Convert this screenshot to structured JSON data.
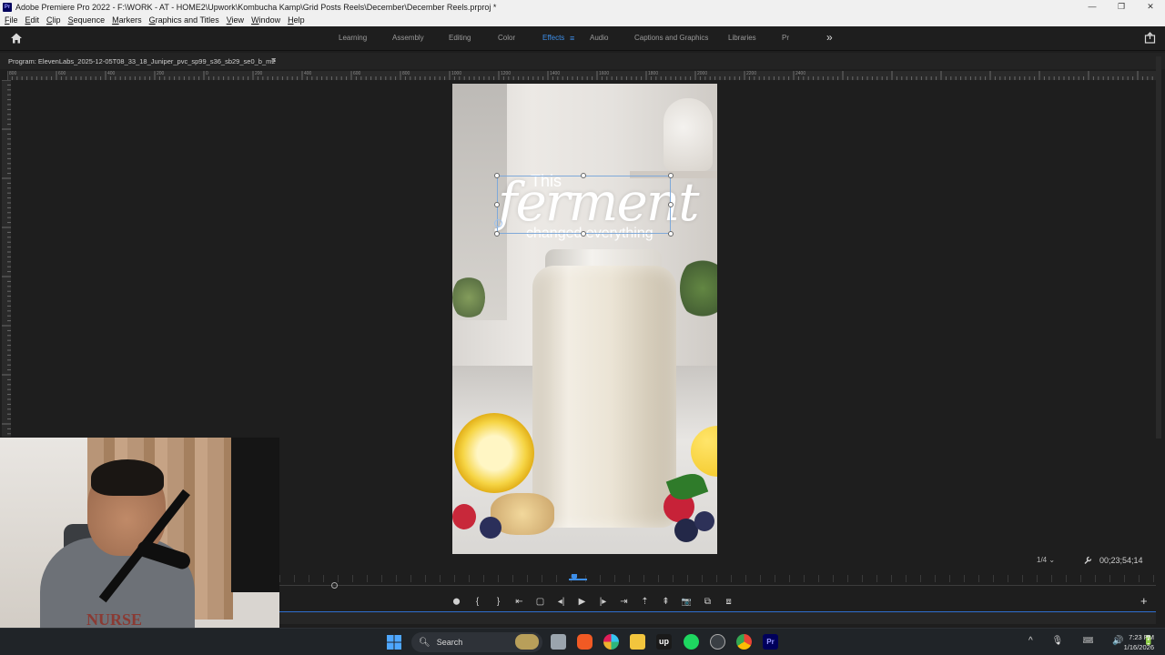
{
  "window": {
    "title": "Adobe Premiere Pro 2022 - F:\\WORK - AT - HOME2\\Upwork\\Kombucha Kamp\\Grid Posts Reels\\December\\December Reels.prproj *",
    "icon": "Pr",
    "controls": [
      "—",
      "❐",
      "✕"
    ]
  },
  "menu": [
    "File",
    "Edit",
    "Clip",
    "Sequence",
    "Markers",
    "Graphics and Titles",
    "View",
    "Window",
    "Help"
  ],
  "workspaces": {
    "tabs": [
      "Learning",
      "Assembly",
      "Editing",
      "Color",
      "Effects",
      "Audio",
      "Captions and Graphics",
      "Libraries",
      "Pr"
    ],
    "active": "Effects",
    "menu_glyph": "≡",
    "more_glyph": "»"
  },
  "program_monitor": {
    "title": "Program: ElevenLabs_2025-12-05T08_33_18_Juniper_pvc_sp99_s36_sb29_se0_b_m2",
    "menu_glyph": "≡",
    "ruler_labels": [
      "800",
      "600",
      "400",
      "200",
      "0",
      "200",
      "400",
      "600",
      "800",
      "1000",
      "1200",
      "1400",
      "1600",
      "1800",
      "2000",
      "2200",
      "2400"
    ],
    "caption": {
      "line1": "This",
      "line2": "ferment",
      "line3": "changed everything"
    },
    "zoom": "1/4",
    "timecode": "00;23;54;14"
  },
  "transport": {
    "buttons": [
      "marker",
      "mark-in",
      "mark-out",
      "go-to-in",
      "safe-margins",
      "step-back",
      "play",
      "step-forward",
      "go-to-out",
      "lift",
      "extract",
      "export-frame",
      "comparison-view",
      "proxy-toggle"
    ],
    "glyphs": [
      "⬤",
      "{",
      "}",
      "⇤",
      "▢",
      "◂|",
      "▶",
      "|▸",
      "⇥",
      "⇡",
      "⇞",
      "📷",
      "⧉",
      "⧈"
    ],
    "add_glyph": "+"
  },
  "taskbar": {
    "search_placeholder": "Search",
    "apps": [
      "start",
      "search",
      "widget-game",
      "file-manager",
      "brave",
      "slack",
      "explorer",
      "upwork",
      "spotify",
      "obs",
      "chrome",
      "premiere"
    ],
    "time": "7:23 PM",
    "date": "1/16/2026",
    "tray": "^ 🎙 ⌨ 🔊 🔋"
  },
  "webcam": {
    "shirt_text": "NURSE"
  },
  "colors": {
    "accent": "#3d8ee8",
    "panel_bg": "#1e1e1e",
    "taskbar_bg": "#202428"
  }
}
